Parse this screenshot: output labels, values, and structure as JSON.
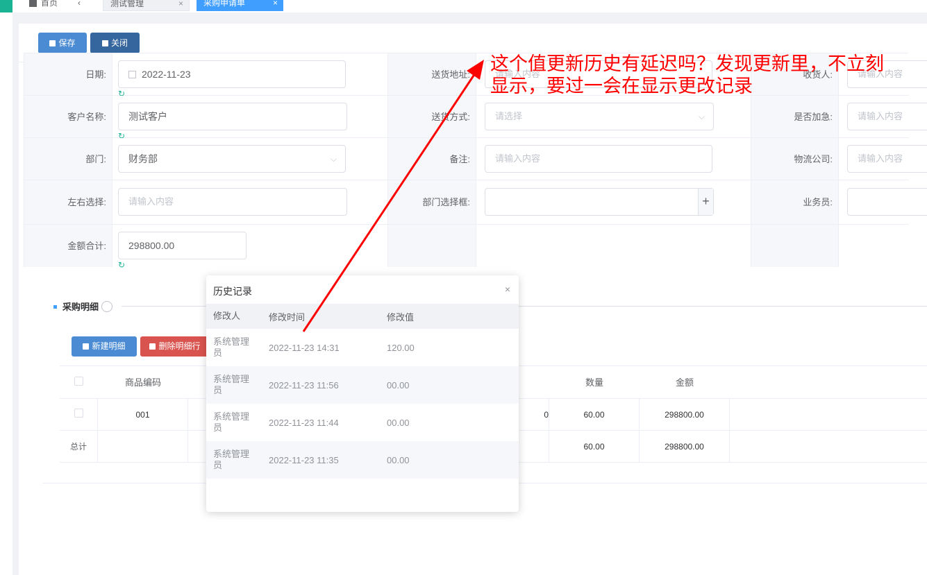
{
  "tabs": {
    "home": "首页",
    "back": "‹",
    "test": "测试管理",
    "active": "采购申请单",
    "close": "×"
  },
  "toolbar": {
    "save": "保存",
    "close": "关闭"
  },
  "form": {
    "date_label": "日期:",
    "date_value": "2022-11-23",
    "customer_label": "客户名称:",
    "customer_value": "测试客户",
    "dept_label": "部门:",
    "dept_value": "财务部",
    "lr_label": "左右选择:",
    "lr_placeholder": "请输入内容",
    "amount_label": "金额合计:",
    "amount_value": "298800.00",
    "addr_label": "送货地址:",
    "addr_placeholder": "请输入内容",
    "ship_label": "送货方式:",
    "ship_placeholder": "请选择",
    "remark_label": "备注:",
    "remark_placeholder": "请输入内容",
    "deptsel_label": "部门选择框:",
    "receiver_label": "收货人:",
    "receiver_placeholder": "请输入内容",
    "urgent_label": "是否加急:",
    "urgent_placeholder": "请输入内容",
    "logistics_label": "物流公司:",
    "logistics_placeholder": "请输入内容",
    "sales_label": "业务员:"
  },
  "detail": {
    "title": "采购明细",
    "add": "新建明细",
    "delete": "删除明细行",
    "headers": {
      "code": "商品编码",
      "qty": "数量",
      "amount": "金额"
    },
    "rows": [
      {
        "code": "001",
        "qty": "60.00",
        "amount": "298800.00",
        "partial": "0"
      }
    ],
    "total": {
      "label": "总计",
      "qty": "60.00",
      "amount": "298800.00"
    }
  },
  "history": {
    "title": "历史记录",
    "close": "×",
    "headers": {
      "user": "修改人",
      "time": "修改时间",
      "value": "修改值"
    },
    "rows": [
      {
        "user": "系统管理员",
        "time": "2022-11-23 14:31",
        "value": "120.00"
      },
      {
        "user": "系统管理员",
        "time": "2022-11-23 11:56",
        "value": "00.00"
      },
      {
        "user": "系统管理员",
        "time": "2022-11-23 11:44",
        "value": "00.00"
      },
      {
        "user": "系统管理员",
        "time": "2022-11-23 11:35",
        "value": "00.00"
      }
    ]
  },
  "annotation": {
    "line1": "这个值更新历史有延迟吗？发现更新里，不立刻",
    "line2": "显示，要过一会在显示更改记录",
    "color": "#ff0000"
  },
  "colors": {
    "primary": "#409eff",
    "save": "#4a8bd3",
    "close": "#35669e",
    "danger": "#d9534f",
    "history_icon": "#1ab394"
  },
  "icons": {
    "history": "↻",
    "plus": "+",
    "dropdown": "⌵"
  }
}
